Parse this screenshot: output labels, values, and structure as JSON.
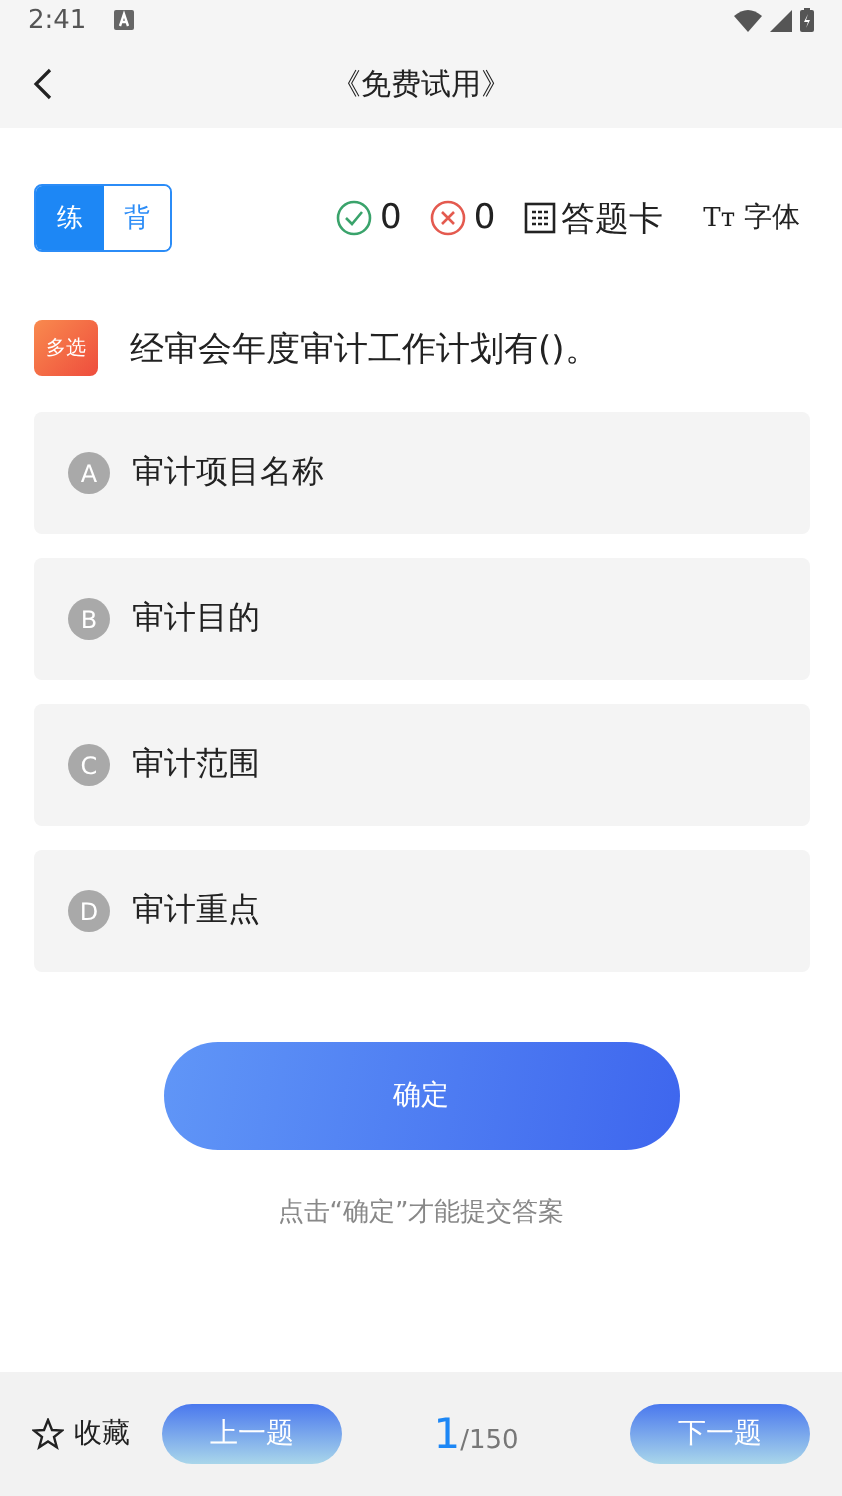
{
  "status_bar": {
    "time": "2:41"
  },
  "header": {
    "title": "《免费试用》"
  },
  "mode_tabs": [
    {
      "label": "练",
      "selected": true
    },
    {
      "label": "背",
      "selected": false
    }
  ],
  "stats": {
    "correct": "0",
    "wrong": "0",
    "answer_card": "答题卡",
    "font_icon": "Tт",
    "font": "字体"
  },
  "question": {
    "type_tag": "多选",
    "text": "经审会年度审计工作计划有()。"
  },
  "options": [
    {
      "letter": "A",
      "text": "审计项目名称",
      "selected": false
    },
    {
      "letter": "B",
      "text": "审计目的",
      "selected": false
    },
    {
      "letter": "C",
      "text": "审计范围",
      "selected": false
    },
    {
      "letter": "D",
      "text": "审计重点",
      "selected": false
    }
  ],
  "confirm_button": "确定",
  "hint": "点击“确定”才能提交答案",
  "footer": {
    "favorite": "收藏",
    "prev": "上一题",
    "current": "1",
    "total": "/150",
    "next": "下一题"
  }
}
